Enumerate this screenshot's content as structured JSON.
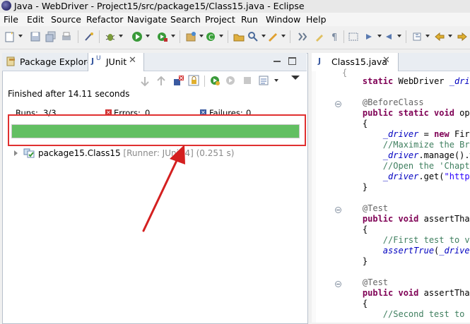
{
  "window": {
    "title": "Java - WebDriver - Project15/src/package15/Class15.java - Eclipse"
  },
  "menu": [
    "File",
    "Edit",
    "Source",
    "Refactor",
    "Navigate",
    "Search",
    "Project",
    "Run",
    "Window",
    "Help"
  ],
  "left_tabs": {
    "package_explorer": "Package Explorer",
    "junit": "JUnit"
  },
  "junit": {
    "status": "Finished after 14.11 seconds",
    "runs_label": "Runs:",
    "runs_value": "3/3",
    "errors_label": "Errors:",
    "errors_value": "0",
    "failures_label": "Failures:",
    "failures_value": "0",
    "progress_fraction": 1.0,
    "progress_color": "#62bf62",
    "tree_item": {
      "name": "package15.Class15",
      "runner": "[Runner: JUnit 4]",
      "time": "(0.251 s)"
    }
  },
  "editor": {
    "tab": "Class15.java",
    "lines": [
      {
        "parts": [
          [
            "",
            "    "
          ],
          [
            "kw",
            "static"
          ],
          [
            "",
            " WebDriver "
          ],
          [
            "fld",
            "_drive"
          ]
        ]
      },
      {
        "parts": [
          [
            "",
            ""
          ]
        ]
      },
      {
        "parts": [
          [
            "ann",
            "    @BeforeClass"
          ]
        ]
      },
      {
        "parts": [
          [
            "kw",
            "    public static void"
          ],
          [
            "",
            " ope"
          ]
        ]
      },
      {
        "parts": [
          [
            "",
            "    {"
          ]
        ]
      },
      {
        "parts": [
          [
            "",
            "        "
          ],
          [
            "fld",
            "_driver"
          ],
          [
            "",
            " = "
          ],
          [
            "kw",
            "new"
          ],
          [
            "",
            " Fire"
          ]
        ]
      },
      {
        "parts": [
          [
            "cmt",
            "        //Maximize the Bro"
          ]
        ]
      },
      {
        "parts": [
          [
            "",
            "        "
          ],
          [
            "fld",
            "_driver"
          ],
          [
            "",
            ".manage().w"
          ]
        ]
      },
      {
        "parts": [
          [
            "cmt",
            "        //Open the 'Chapte"
          ]
        ]
      },
      {
        "parts": [
          [
            "",
            "        "
          ],
          [
            "fld",
            "_driver"
          ],
          [
            "",
            ".get("
          ],
          [
            "str",
            "\"http:"
          ]
        ]
      },
      {
        "parts": [
          [
            "",
            "    }"
          ]
        ]
      },
      {
        "parts": [
          [
            "",
            ""
          ]
        ]
      },
      {
        "parts": [
          [
            "ann",
            "    @Test"
          ]
        ]
      },
      {
        "parts": [
          [
            "kw",
            "    public void"
          ],
          [
            "",
            " assertThat"
          ]
        ]
      },
      {
        "parts": [
          [
            "",
            "    {"
          ]
        ]
      },
      {
        "parts": [
          [
            "cmt",
            "        //First test to ve"
          ]
        ]
      },
      {
        "parts": [
          [
            "",
            "        "
          ],
          [
            "fld",
            "assertTrue"
          ],
          [
            "",
            "("
          ],
          [
            "fld",
            "_driver"
          ]
        ]
      },
      {
        "parts": [
          [
            "",
            "    }"
          ]
        ]
      },
      {
        "parts": [
          [
            "",
            ""
          ]
        ]
      },
      {
        "parts": [
          [
            "ann",
            "    @Test"
          ]
        ]
      },
      {
        "parts": [
          [
            "kw",
            "    public void"
          ],
          [
            "",
            " assertThat"
          ]
        ]
      },
      {
        "parts": [
          [
            "",
            "    {"
          ]
        ]
      },
      {
        "parts": [
          [
            "cmt",
            "        //Second test to v"
          ]
        ]
      }
    ]
  },
  "annotation": {
    "highlight_color": "#e03030",
    "arrow_color": "#d42020"
  }
}
